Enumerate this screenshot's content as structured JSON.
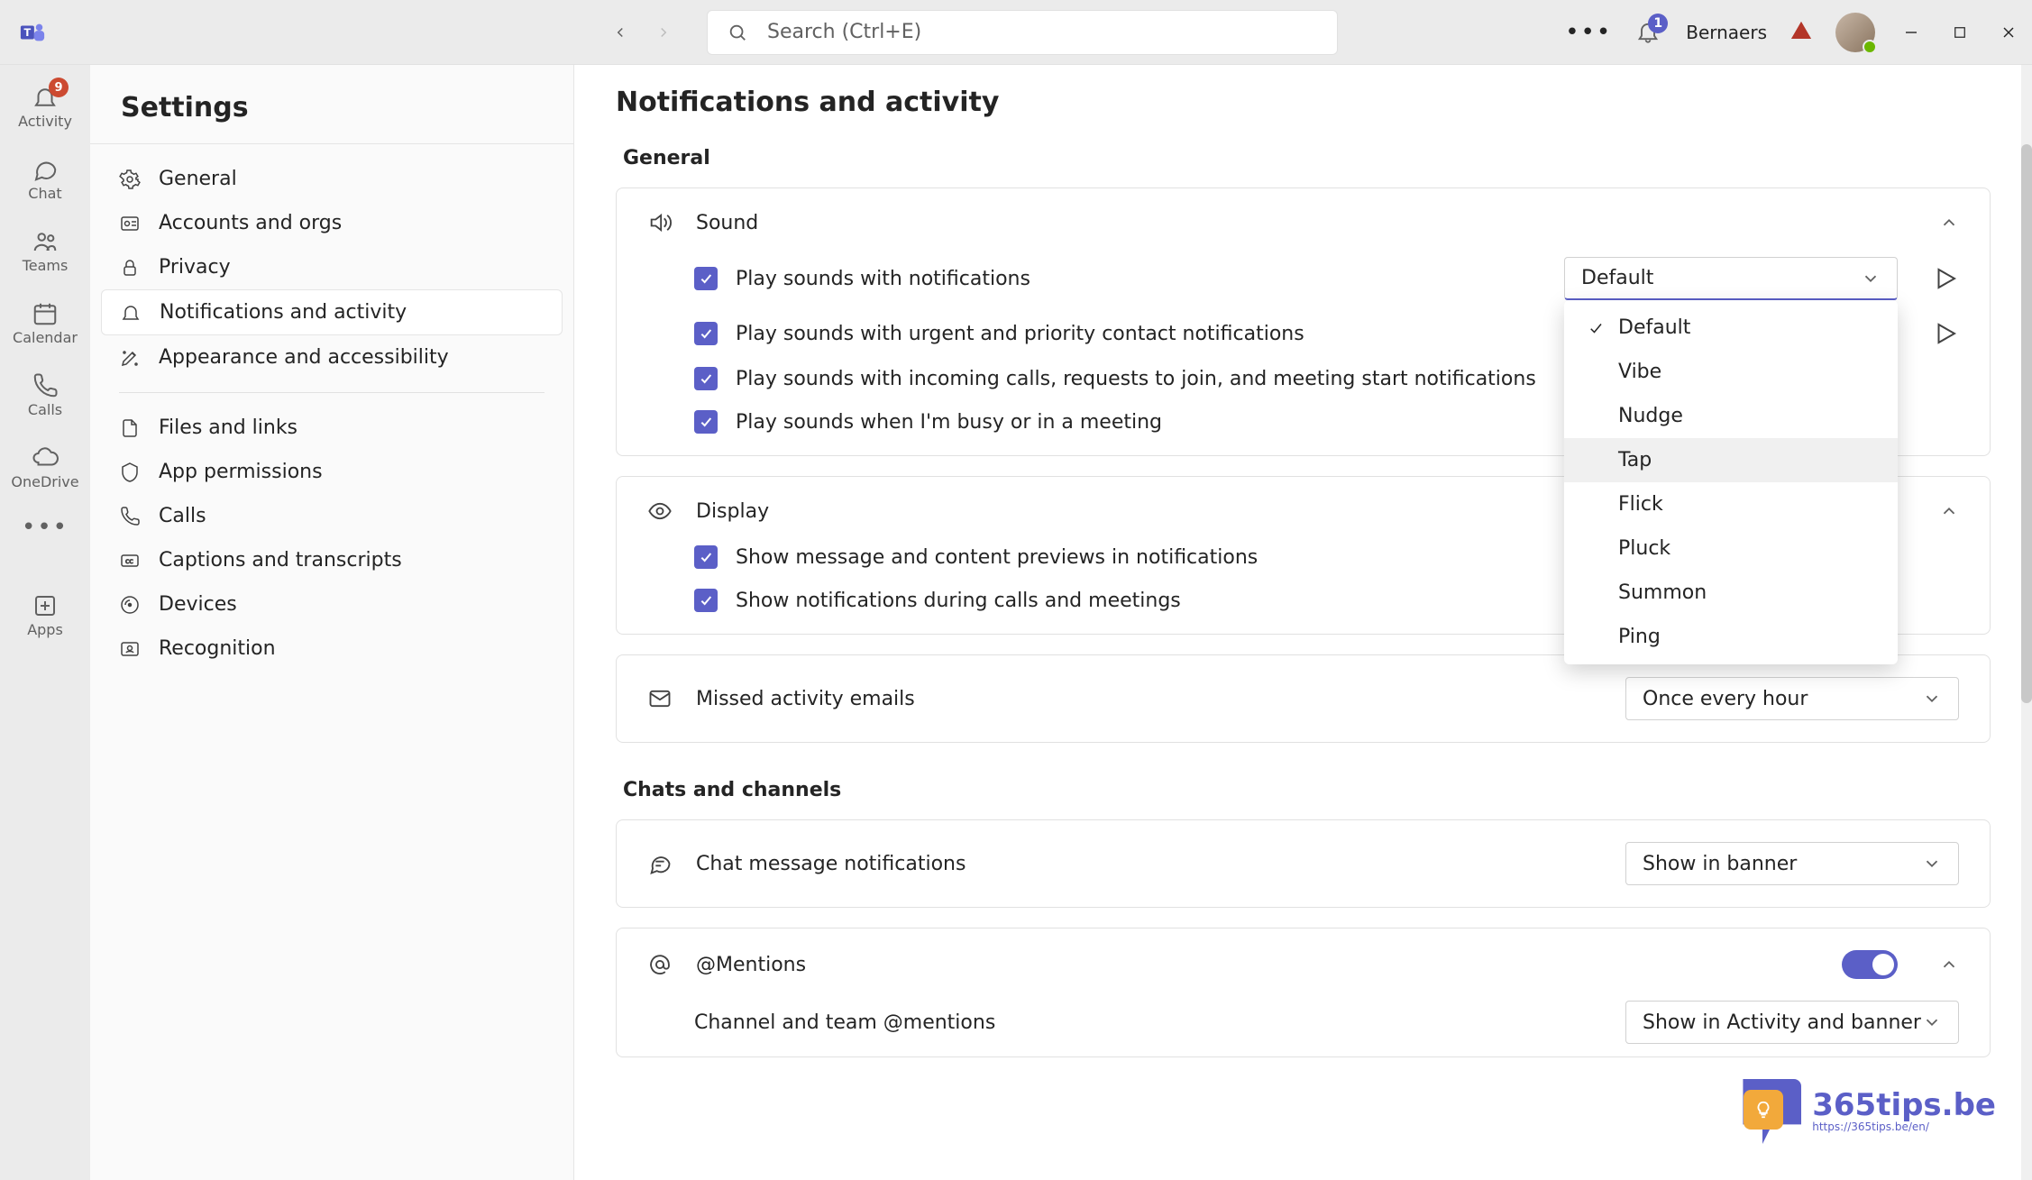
{
  "titlebar": {
    "search_placeholder": "Search (Ctrl+E)",
    "bell_badge": "1",
    "username": "Bernaers"
  },
  "rail": {
    "items": [
      {
        "label": "Activity",
        "badge": "9"
      },
      {
        "label": "Chat"
      },
      {
        "label": "Teams"
      },
      {
        "label": "Calendar"
      },
      {
        "label": "Calls"
      },
      {
        "label": "OneDrive"
      }
    ],
    "apps_label": "Apps"
  },
  "settings": {
    "title": "Settings",
    "items": [
      "General",
      "Accounts and orgs",
      "Privacy",
      "Notifications and activity",
      "Appearance and accessibility"
    ],
    "items2": [
      "Files and links",
      "App permissions",
      "Calls",
      "Captions and transcripts",
      "Devices",
      "Recognition"
    ]
  },
  "main": {
    "title": "Notifications and activity",
    "section_general": "General",
    "sound": {
      "header": "Sound",
      "opt1": "Play sounds with notifications",
      "opt2": "Play sounds with urgent and priority contact notifications",
      "opt3": "Play sounds with incoming calls, requests to join, and meeting start notifications",
      "opt4": "Play sounds when I'm busy or in a meeting",
      "select_value": "Default",
      "options": [
        "Default",
        "Vibe",
        "Nudge",
        "Tap",
        "Flick",
        "Pluck",
        "Summon",
        "Ping"
      ],
      "selected_index": 0,
      "hover_index": 3
    },
    "display": {
      "header": "Display",
      "opt1": "Show message and content previews in notifications",
      "opt2": "Show notifications during calls and meetings"
    },
    "missed": {
      "header": "Missed activity emails",
      "select_value": "Once every hour"
    },
    "section_chats": "Chats and channels",
    "chat_notif": {
      "header": "Chat message notifications",
      "select_value": "Show in banner"
    },
    "mentions": {
      "header": "@Mentions",
      "sub": "Channel and team @mentions",
      "select_value": "Show in Activity and banner"
    }
  },
  "watermark": {
    "text": "365tips.be",
    "sub": "https://365tips.be/en/"
  },
  "colors": {
    "accent": "#5B5FC7",
    "badge_red": "#cc4a31"
  }
}
